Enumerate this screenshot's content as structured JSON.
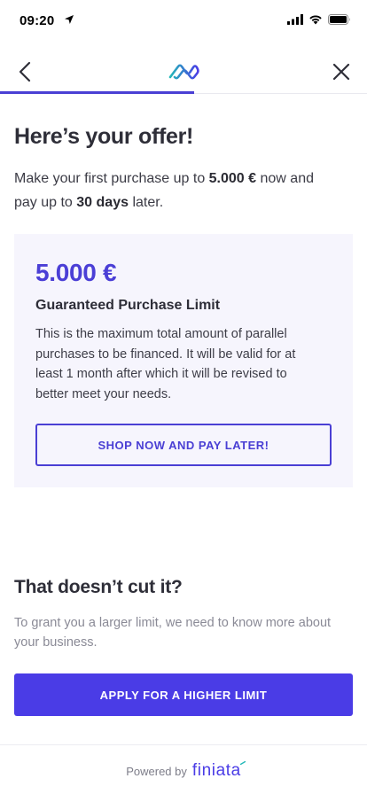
{
  "status_bar": {
    "time": "09:20"
  },
  "nav": {
    "progress_fraction": 0.53
  },
  "offer": {
    "title": "Here’s your offer!",
    "intro_prefix": "Make your first purchase up to ",
    "intro_amount": "5.000 €",
    "intro_middle": " now and pay up to ",
    "intro_days": "30 days",
    "intro_suffix": " later.",
    "card": {
      "amount": "5.000 €",
      "label": "Guaranteed Purchase Limit",
      "description": "This is the maximum total amount of parallel purchases to be financed. It will be valid for at least 1 month after which it will be revised to better meet your needs.",
      "shop_button": "SHOP NOW AND PAY LATER!"
    }
  },
  "higher_limit": {
    "title": "That doesn’t cut it?",
    "text": "To grant you a larger limit, we need to know more about your business.",
    "apply_button": "APPLY FOR A HIGHER LIMIT"
  },
  "footer": {
    "powered_by": "Powered by",
    "brand": "finiata"
  },
  "colors": {
    "accent": "#4a3fd4",
    "card_bg": "#f6f5fd",
    "button_bg": "#4a3ce6",
    "logo_teal": "#22b8b8"
  },
  "icons": [
    "location-arrow-icon",
    "signal-icon",
    "wifi-icon",
    "battery-icon",
    "back-arrow-icon",
    "finiata-logo-icon",
    "close-icon"
  ]
}
